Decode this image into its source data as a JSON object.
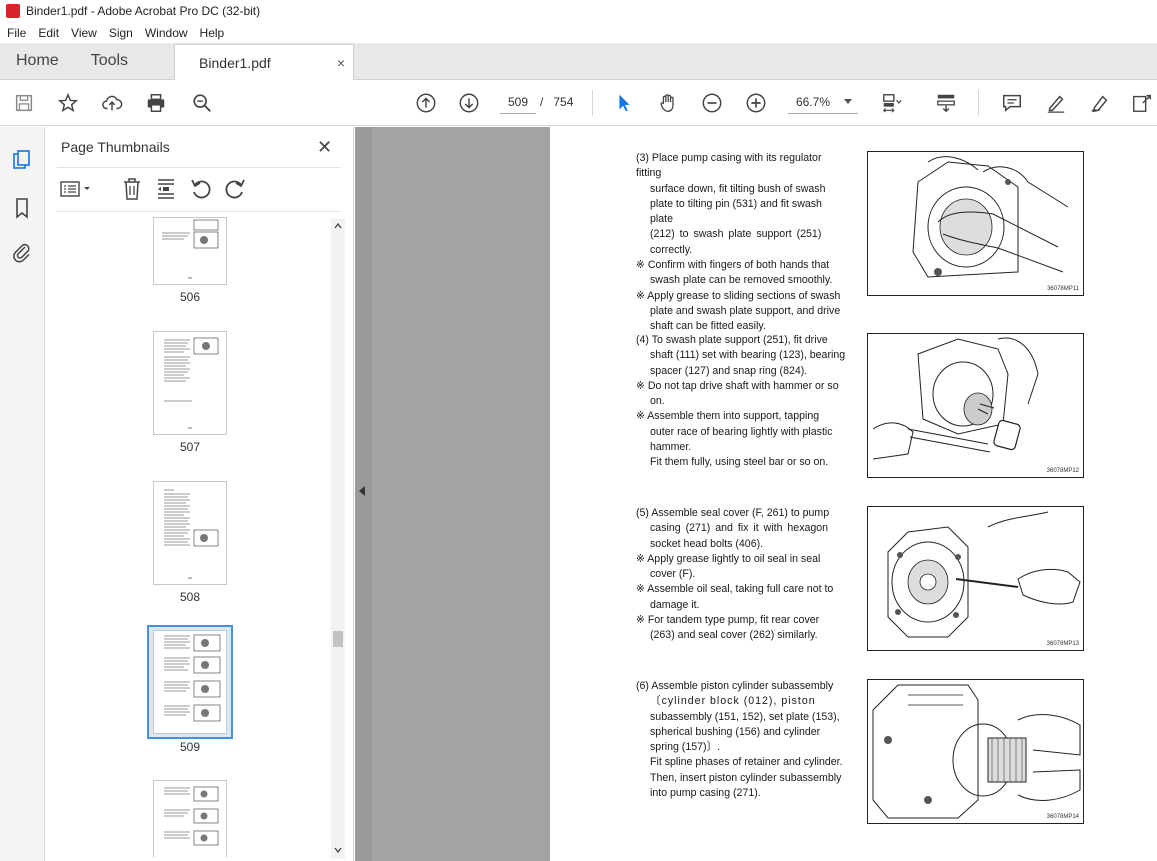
{
  "window": {
    "title": "Binder1.pdf - Adobe Acrobat Pro DC (32-bit)"
  },
  "menu": [
    "File",
    "Edit",
    "View",
    "Sign",
    "Window",
    "Help"
  ],
  "tabs": {
    "home": "Home",
    "tools": "Tools",
    "document": "Binder1.pdf",
    "close": "×"
  },
  "toolbar": {
    "page_current": "509",
    "page_sep": "/",
    "page_total": "754",
    "zoom": "66.7%"
  },
  "thumbnails": {
    "title": "Page Thumbnails",
    "close": "✕",
    "pages": [
      "506",
      "507",
      "508",
      "509"
    ],
    "selected": "509"
  },
  "document": {
    "steps": [
      {
        "lines": [
          "(3) Place pump casing with its regulator fitting",
          "surface down, fit tilting bush of swash",
          "plate to tilting pin (531) and fit swash plate",
          "(212) to swash plate support (251)",
          "correctly.",
          "※  Confirm with fingers of both hands that",
          "swash plate can be removed smoothly.",
          "※  Apply grease to sliding sections of swash",
          "plate and swash plate support, and drive",
          "shaft can be fitted easily."
        ],
        "figure_code": "36078MP11"
      },
      {
        "lines": [
          "(4) To swash plate support (251), fit drive",
          "shaft (111) set with bearing (123), bearing",
          "spacer (127) and snap ring (824).",
          "※  Do not tap drive shaft with hammer or so",
          "on.",
          "※  Assemble them into support, tapping",
          "outer race of bearing lightly with plastic",
          "hammer.",
          "Fit them fully, using steel bar or so on."
        ],
        "figure_code": "36078MP12"
      },
      {
        "lines": [
          "(5) Assemble seal cover (F, 261) to pump",
          "casing (271) and fix it with hexagon",
          "socket head bolts (406).",
          "※  Apply grease lightly to oil seal in seal",
          "cover (F).",
          "※  Assemble oil seal, taking full care not to",
          "damage it.",
          "※  For tandem type pump, fit rear cover",
          "(263) and seal cover (262) similarly."
        ],
        "figure_code": "36078MP13"
      },
      {
        "lines": [
          "(6) Assemble piston cylinder subassembly",
          "〔cylinder block (012), piston",
          "subassembly (151, 152), set plate (153),",
          "spherical bushing (156) and cylinder",
          "spring (157)〕.",
          "Fit spline phases of retainer and cylinder.",
          "Then, insert piston cylinder subassembly",
          "into pump casing (271)."
        ],
        "figure_code": "36078MP14"
      }
    ]
  },
  "colors": {
    "accent": "#4a90d9",
    "pdf_red": "#d8232a",
    "select_cursor": "#1473e6"
  }
}
